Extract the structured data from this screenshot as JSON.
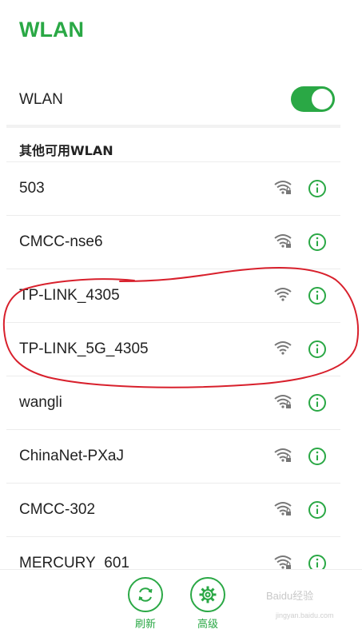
{
  "header": {
    "title": "WLAN"
  },
  "wlan_toggle": {
    "label": "WLAN",
    "enabled": true,
    "accent_color": "#2aa845"
  },
  "section": {
    "title": "其他可用WLAN"
  },
  "networks": [
    {
      "name": "503",
      "secured": true,
      "icon": "wifi-lock-icon"
    },
    {
      "name": "CMCC-nse6",
      "secured": true,
      "icon": "wifi-lock-icon"
    },
    {
      "name": "TP-LINK_4305",
      "secured": false,
      "icon": "wifi-icon"
    },
    {
      "name": "TP-LINK_5G_4305",
      "secured": false,
      "icon": "wifi-icon"
    },
    {
      "name": "wangli",
      "secured": true,
      "icon": "wifi-lock-icon"
    },
    {
      "name": "ChinaNet-PXaJ",
      "secured": true,
      "icon": "wifi-lock-icon"
    },
    {
      "name": "CMCC-302",
      "secured": true,
      "icon": "wifi-lock-icon"
    },
    {
      "name": "MERCURY_601",
      "secured": true,
      "icon": "wifi-lock-icon"
    }
  ],
  "bottom_bar": {
    "refresh_label": "刷新",
    "advanced_label": "高级"
  },
  "watermark": {
    "text": "Baidu经验",
    "sub": "jingyan.baidu.com"
  }
}
